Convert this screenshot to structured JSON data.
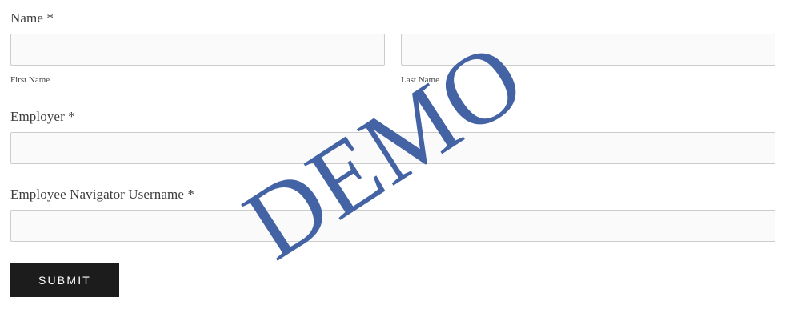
{
  "form": {
    "name": {
      "label": "Name *",
      "first_caption": "First Name",
      "last_caption": "Last Name",
      "first_value": "",
      "last_value": ""
    },
    "employer": {
      "label": "Employer *",
      "value": ""
    },
    "username": {
      "label": "Employee Navigator Username *",
      "value": ""
    },
    "submit_label": "SUBMIT"
  },
  "watermark": {
    "text": "DEMO",
    "color": "#4463a4"
  },
  "colors": {
    "field_background": "#fafafa",
    "field_border": "#cccccc",
    "button_background": "#1c1c1c",
    "button_text": "#ffffff"
  }
}
